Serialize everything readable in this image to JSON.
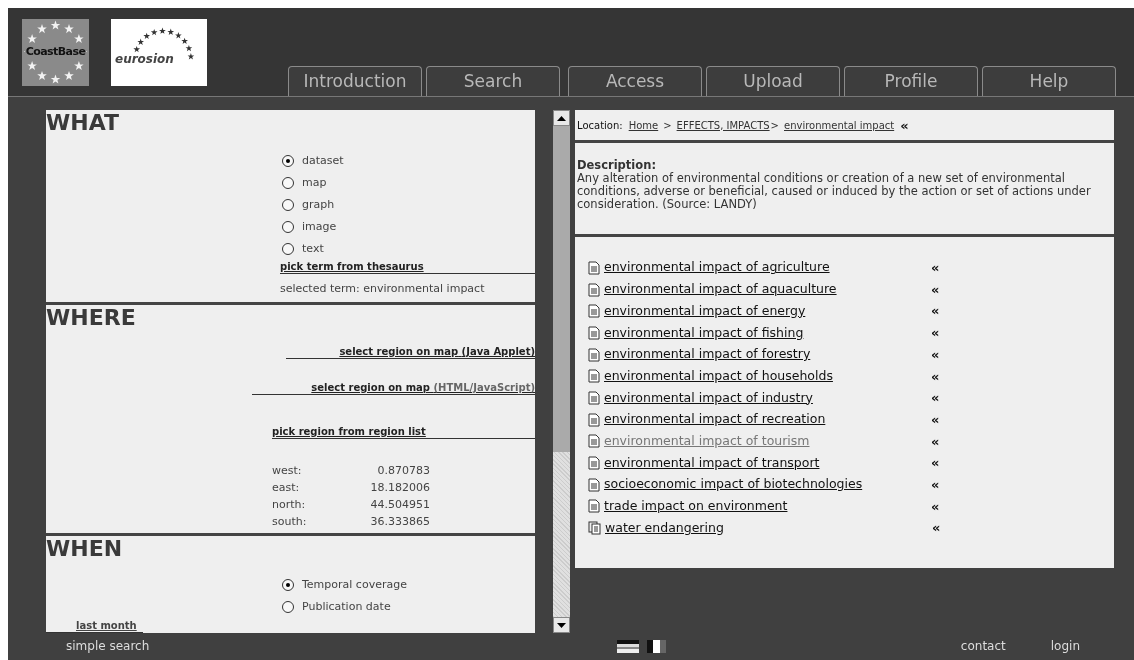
{
  "logos": [
    "CoastBase",
    "eurosion"
  ],
  "tabs": [
    {
      "label": "Introduction",
      "selected": false
    },
    {
      "label": "Search",
      "selected": false
    },
    {
      "label": "Access",
      "selected": false
    },
    {
      "label": "Upload",
      "selected": false
    },
    {
      "label": "Profile",
      "selected": false
    },
    {
      "label": "Help",
      "selected": false
    }
  ],
  "what": {
    "heading": "WHAT",
    "options": [
      {
        "label": "dataset",
        "checked": true
      },
      {
        "label": "map",
        "checked": false
      },
      {
        "label": "graph",
        "checked": false
      },
      {
        "label": "image",
        "checked": false
      },
      {
        "label": "text",
        "checked": false
      }
    ],
    "link": "pick term from thesaurus",
    "selected_term": "selected term: environmental impact"
  },
  "where": {
    "heading": "WHERE",
    "links": [
      {
        "label": "select region on map",
        "note": "(Java Applet)"
      },
      {
        "label": "select region on map",
        "note": "(HTML/JavaScript)"
      },
      {
        "label": "pick region from region list"
      }
    ],
    "coordinates": [
      {
        "label": "west:",
        "value": "0.870783"
      },
      {
        "label": "east:",
        "value": "18.182006"
      },
      {
        "label": "north:",
        "value": "44.504951"
      },
      {
        "label": "south:",
        "value": "36.333865"
      }
    ]
  },
  "when": {
    "heading": "WHEN",
    "options": [
      {
        "label": "Temporal coverage",
        "checked": true
      },
      {
        "label": "Publication date",
        "checked": false
      }
    ],
    "link": "last month"
  },
  "location": {
    "label": "Location:",
    "crumbs": [
      "Home",
      "EFFECTS, IMPACTS",
      "environmental impact"
    ],
    "separators": [
      ">",
      ">"
    ],
    "up": "«"
  },
  "description": {
    "label": "Description:",
    "text": "Any alteration of environmental conditions or creation of a new set of environmental conditions, adverse or beneficial, caused or induced by the action or set of actions under consideration. (Source: LANDY)"
  },
  "terms": [
    {
      "label": "environmental impact of agriculture",
      "kind": "term",
      "visited": false,
      "up": "«"
    },
    {
      "label": "environmental impact of aquaculture",
      "kind": "term",
      "visited": false,
      "up": "«"
    },
    {
      "label": "environmental impact of energy",
      "kind": "term",
      "visited": false,
      "up": "«"
    },
    {
      "label": "environmental impact of fishing",
      "kind": "term",
      "visited": false,
      "up": "«"
    },
    {
      "label": "environmental impact of forestry",
      "kind": "term",
      "visited": false,
      "up": "«"
    },
    {
      "label": "environmental impact of households",
      "kind": "term",
      "visited": false,
      "up": "«"
    },
    {
      "label": "environmental impact of industry",
      "kind": "term",
      "visited": false,
      "up": "«"
    },
    {
      "label": "environmental impact of recreation",
      "kind": "term",
      "visited": false,
      "up": "«"
    },
    {
      "label": "environmental impact of tourism",
      "kind": "term",
      "visited": true,
      "up": "«"
    },
    {
      "label": "environmental impact of transport",
      "kind": "term",
      "visited": false,
      "up": "«"
    },
    {
      "label": "socioeconomic impact of biotechnologies",
      "kind": "term",
      "visited": false,
      "up": "«"
    },
    {
      "label": "trade impact on environment",
      "kind": "term",
      "visited": false,
      "up": "«"
    },
    {
      "label": "water endangering",
      "kind": "group",
      "visited": false,
      "up": "«"
    }
  ],
  "footer": {
    "left": "simple search",
    "links": [
      "contact",
      "login"
    ]
  }
}
